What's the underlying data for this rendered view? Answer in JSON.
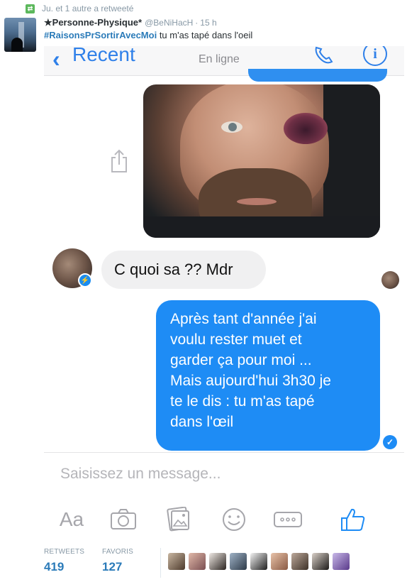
{
  "context": {
    "retweeted_by": "Ju. et 1 autre a retweeté"
  },
  "tweet": {
    "display_name": "★Personne-Physique*",
    "username": "@BeNiHacH",
    "separator": "·",
    "time": "15 h",
    "hashtag": "#RaisonsPrSortirAvecMoi",
    "text": "tu m'as tapé dans l'oeil"
  },
  "messenger": {
    "back_label": "Recent",
    "status": "En ligne",
    "incoming_message": "C quoi sa ?? Mdr",
    "outgoing_lines": [
      "Après tant d'année j'ai",
      "voulu rester muet et",
      "garder ça pour moi ...",
      "Mais aujourd'hui 3h30 je",
      "te le dis : tu m'as tapé",
      "dans l'œil"
    ],
    "input_placeholder": "Saisissez un message...",
    "toolbar": [
      "text-format-icon",
      "camera-icon",
      "photos-icon",
      "emoji-icon",
      "more-icon",
      "like-icon"
    ],
    "aa_label": "Aa",
    "accent_color": "#1e8cf5"
  },
  "stats": {
    "retweets_label": "RETWEETS",
    "retweets_value": "419",
    "favorites_label": "FAVORIS",
    "favorites_value": "127"
  },
  "colors": {
    "link": "#2b7bb9",
    "muted": "#8899a6",
    "retweet_green": "#5cb85c"
  }
}
